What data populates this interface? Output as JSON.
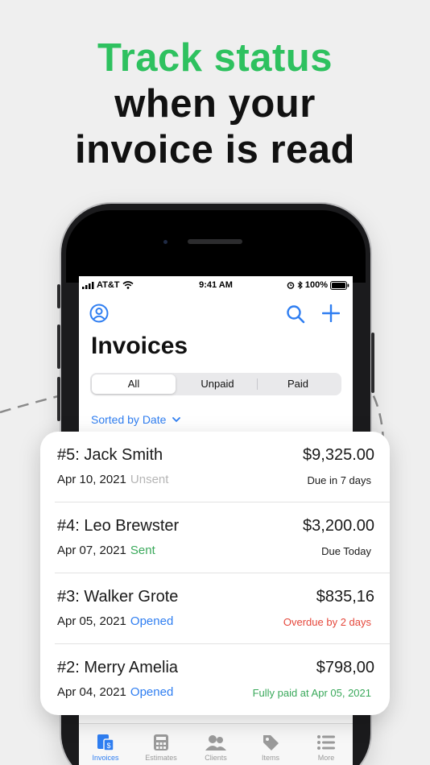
{
  "headline": {
    "line1": "Track status",
    "line2": "when your",
    "line3": "invoice is read",
    "accent_color": "#2ec15f"
  },
  "status_bar": {
    "carrier": "AT&T",
    "time": "9:41 AM",
    "battery": "100%",
    "icons": [
      "signal-icon",
      "wifi-icon",
      "alarm-icon",
      "bluetooth-icon",
      "battery-icon"
    ]
  },
  "nav": {
    "profile_icon": "profile-icon",
    "search_icon": "search-icon",
    "add_icon": "plus-icon",
    "accent_color": "#2f7ef1"
  },
  "page": {
    "title": "Invoices"
  },
  "segments": {
    "all": "All",
    "unpaid": "Unpaid",
    "paid": "Paid",
    "selected": "All"
  },
  "sort": {
    "label": "Sorted by Date",
    "icon": "chevron-down-icon"
  },
  "invoices": [
    {
      "name": "#5: Jack Smith",
      "date": "Apr 10, 2021",
      "status": "Unsent",
      "status_color": "#b5b5b5",
      "amount": "$9,325.00",
      "due": "Due in 7 days",
      "due_color": "#1a1a1a"
    },
    {
      "name": "#4: Leo Brewster",
      "date": "Apr 07, 2021",
      "status": "Sent",
      "status_color": "#3aa95b",
      "amount": "$3,200.00",
      "due": "Due Today",
      "due_color": "#1a1a1a"
    },
    {
      "name": "#3: Walker Grote",
      "date": "Apr 05, 2021",
      "status": "Opened",
      "status_color": "#2f7ef1",
      "amount": "$835,16",
      "due": "Overdue by 2 days",
      "due_color": "#e5473b"
    },
    {
      "name": "#2: Merry Amelia",
      "date": "Apr 04, 2021",
      "status": "Opened",
      "status_color": "#2f7ef1",
      "amount": "$798,00",
      "due": "Fully paid at Apr 05, 2021",
      "due_color": "#3aa95b"
    }
  ],
  "tabbar": {
    "invoices": "Invoices",
    "estimates": "Estimates",
    "clients": "Clients",
    "items": "Items",
    "more": "More",
    "active": "Invoices"
  }
}
